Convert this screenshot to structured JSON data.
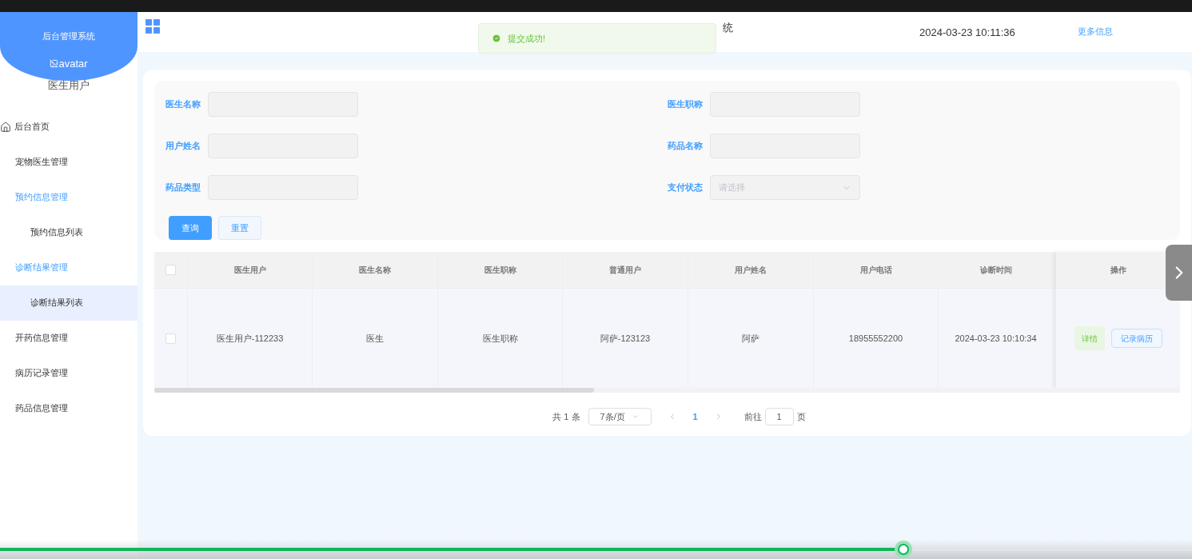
{
  "sidebar": {
    "title": "后台管理系统",
    "avatar_alt": "avatar",
    "user": "医生用户",
    "items": [
      {
        "label": "后台首页",
        "kind": "home",
        "selected": false
      },
      {
        "label": "宠物医生管理",
        "kind": "group",
        "selected": false
      },
      {
        "label": "预约信息管理",
        "kind": "group",
        "expanded": true,
        "selected": false,
        "children": [
          {
            "label": "预约信息列表",
            "selected": false
          }
        ]
      },
      {
        "label": "诊断结果管理",
        "kind": "group",
        "expanded": true,
        "selected": false,
        "children": [
          {
            "label": "诊断结果列表",
            "selected": true
          }
        ]
      },
      {
        "label": "开药信息管理",
        "kind": "group",
        "selected": false
      },
      {
        "label": "病历记录管理",
        "kind": "group",
        "selected": false
      },
      {
        "label": "药品信息管理",
        "kind": "group",
        "selected": false
      }
    ]
  },
  "header": {
    "title": "统",
    "datetime": "2024-03-23 10:11:36",
    "more": "更多信息"
  },
  "toast": {
    "message": "提交成功!"
  },
  "filters": [
    {
      "label": "医生名称",
      "kind": "input"
    },
    {
      "label": "医生职称",
      "kind": "input"
    },
    {
      "label": "用户姓名",
      "kind": "input"
    },
    {
      "label": "药品名称",
      "kind": "input"
    },
    {
      "label": "药品类型",
      "kind": "input"
    },
    {
      "label": "支付状态",
      "kind": "select",
      "placeholder": "请选择"
    }
  ],
  "buttons": {
    "search": "查询",
    "reset": "重置"
  },
  "table": {
    "columns": [
      "医生用户",
      "医生名称",
      "医生职称",
      "普通用户",
      "用户姓名",
      "用户电话",
      "诊断时间",
      "操作"
    ],
    "rows": [
      {
        "checked": false,
        "cells": [
          "医生用户-112233",
          "医生",
          "医生职称",
          "阿萨-123123",
          "阿萨",
          "18955552200",
          "2024-03-23 10:10:34"
        ],
        "actions": [
          "详情",
          "记录病历"
        ]
      }
    ],
    "header_checked": false
  },
  "pagination": {
    "total": "共 1 条",
    "page_size": "7条/页",
    "pages": [
      {
        "label": "1",
        "selected": true
      }
    ],
    "goto_prefix": "前往",
    "goto_value": "1",
    "goto_suffix": "页"
  },
  "video": {
    "level": 0.758
  }
}
